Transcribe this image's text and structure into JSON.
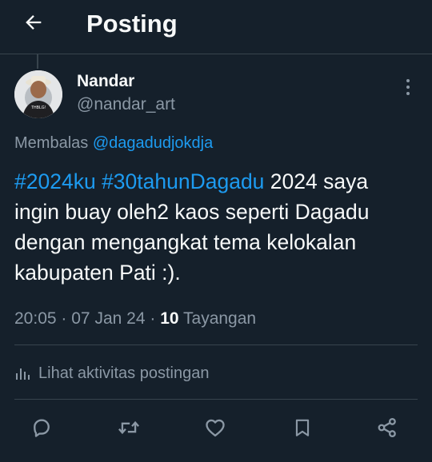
{
  "header": {
    "title": "Posting",
    "back_icon": "arrow-left-icon"
  },
  "post": {
    "author": {
      "name": "Nandar",
      "handle": "@nandar_art",
      "avatar_shirt_text": "THBLG!"
    },
    "replying_to": {
      "prefix": "Membalas",
      "handle": "@dagadudjokdja"
    },
    "hashtags": [
      "#2024ku",
      "#30tahunDagadu"
    ],
    "body_text": "2024 saya ingin buay oleh2 kaos seperti Dagadu dengan mengangkat tema kelokalan kabupaten Pati :).",
    "time": "20:05",
    "separator": "·",
    "date": "07 Jan 24",
    "views_count": "10",
    "views_label": "Tayangan"
  },
  "activity": {
    "label": "Lihat aktivitas postingan",
    "icon": "bar-chart-icon"
  },
  "actions": [
    {
      "name": "reply",
      "icon": "reply-icon"
    },
    {
      "name": "repost",
      "icon": "repost-icon"
    },
    {
      "name": "like",
      "icon": "heart-icon"
    },
    {
      "name": "bookmark",
      "icon": "bookmark-icon"
    },
    {
      "name": "share",
      "icon": "share-icon"
    }
  ],
  "colors": {
    "background": "#15202b",
    "text_primary": "#f7f9f9",
    "text_secondary": "#8b98a5",
    "link": "#1d9bf0",
    "divider": "#38444d"
  }
}
